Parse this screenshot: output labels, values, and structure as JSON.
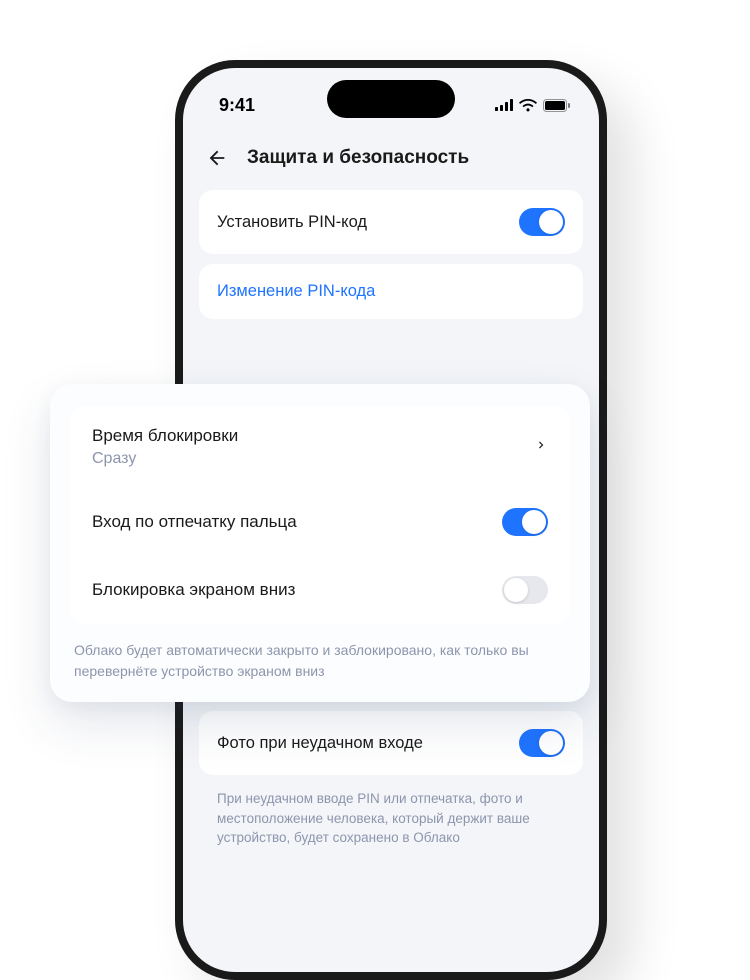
{
  "status": {
    "time": "9:41"
  },
  "header": {
    "title": "Защита и безопасность"
  },
  "pin": {
    "set_label": "Установить PIN-код",
    "set_on": true,
    "change_label": "Изменение PIN-кода"
  },
  "overlay": {
    "lock_time": {
      "label": "Время блокировки",
      "value": "Сразу"
    },
    "fingerprint": {
      "label": "Вход по отпечатку пальца",
      "on": true
    },
    "screen_down": {
      "label": "Блокировка экраном вниз",
      "on": false
    },
    "hint": "Облако будет автоматически закрыто и заблокировано, как только вы перевернёте устройство экраном вниз"
  },
  "intruder": {
    "label": "Фото при неудачном входе",
    "on": true,
    "hint": "При неудачном вводе PIN или отпечатка, фото и местоположение человека, который держит ваше устройство, будет сохранено в Облако"
  },
  "colors": {
    "accent": "#1f74ff",
    "muted": "#8d95ad",
    "bg": "#f3f5f8"
  }
}
